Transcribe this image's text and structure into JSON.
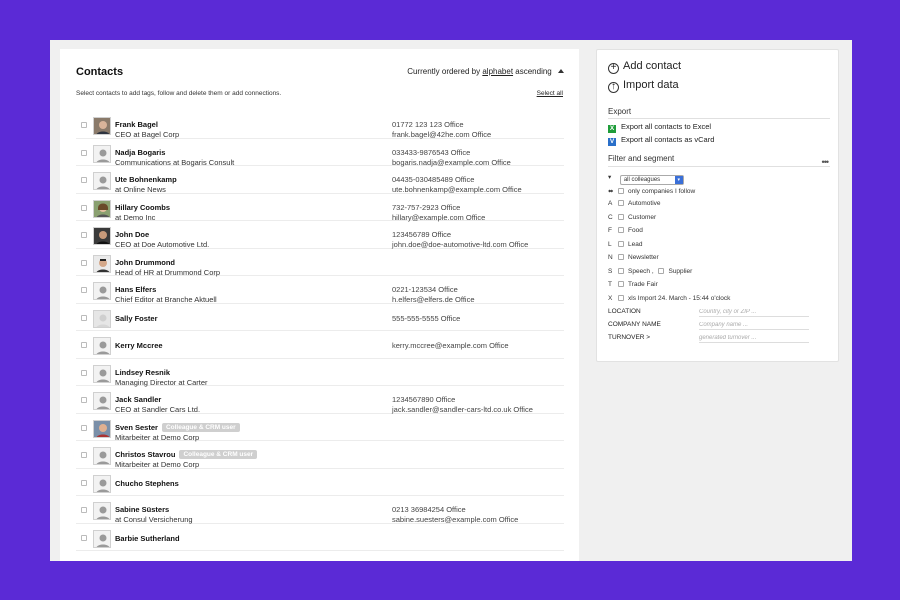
{
  "main": {
    "title": "Contacts",
    "order_prefix": "Currently ordered by",
    "order_link": "alphabet",
    "order_dir": "ascending",
    "instructions": "Select contacts to add tags, follow and delete them or add connections.",
    "select_all": "Select all"
  },
  "contacts": [
    {
      "name": "Frank Bagel",
      "sub": "CEO at Bagel Corp",
      "phone": "01772 123 123 Office",
      "email": "frank.bagel@42he.com Office",
      "avatar": "photo-man-1"
    },
    {
      "name": "Nadja Bogaris",
      "sub": "Communications at Bogaris Consult",
      "phone": "033433-9876543 Office",
      "email": "bogaris.nadja@example.com Office",
      "avatar": "placeholder"
    },
    {
      "name": "Ute Bohnenkamp",
      "sub": "at Online News",
      "phone": "04435-030485489 Office",
      "email": "ute.bohnenkamp@example.com Office",
      "avatar": "placeholder"
    },
    {
      "name": "Hillary Coombs",
      "sub": "at Demo Inc",
      "phone": "732-757-2923 Office",
      "email": "hillary@example.com Office",
      "avatar": "photo-woman-1"
    },
    {
      "name": "John Doe",
      "sub": "CEO at Doe Automotive Ltd.",
      "phone": "123456789 Office",
      "email": "john.doe@doe-automotive-ltd.com Office",
      "avatar": "photo-man-2"
    },
    {
      "name": "John Drummond",
      "sub": "Head of HR at Drummond Corp",
      "phone": "",
      "email": "",
      "avatar": "photo-man-3"
    },
    {
      "name": "Hans Elfers",
      "sub": "Chief Editor at Branche Aktuell",
      "phone": "0221-123534 Office",
      "email": "h.elfers@elfers.de Office",
      "avatar": "placeholder"
    },
    {
      "name": "Sally Foster",
      "sub": "",
      "phone": "",
      "email": "555-555-5555 Office",
      "avatar": "photo-woman-2"
    },
    {
      "name": "Kerry Mccree",
      "sub": "",
      "phone": "",
      "email": "kerry.mccree@example.com Office",
      "avatar": "placeholder"
    },
    {
      "name": "Lindsey Resnik",
      "sub": "Managing Director at Carter",
      "phone": "",
      "email": "",
      "avatar": "placeholder"
    },
    {
      "name": "Jack Sandler",
      "sub": "CEO at Sandler Cars Ltd.",
      "phone": "1234567890 Office",
      "email": "jack.sandler@sandler-cars-ltd.co.uk Office",
      "avatar": "placeholder"
    },
    {
      "name": "Sven Sester",
      "badge": "Colleague & CRM user",
      "sub": "Mitarbeiter at Demo Corp",
      "phone": "",
      "email": "",
      "avatar": "photo-man-4"
    },
    {
      "name": "Christos Stavrou",
      "badge": "Colleague & CRM user",
      "sub": "Mitarbeiter at Demo Corp",
      "phone": "",
      "email": "",
      "avatar": "placeholder"
    },
    {
      "name": "Chucho Stephens",
      "sub": "",
      "phone": "",
      "email": "",
      "avatar": "placeholder"
    },
    {
      "name": "Sabine Süsters",
      "sub": "at Consul Versicherung",
      "phone": "0213 36984254 Office",
      "email": "sabine.suesters@example.com Office",
      "avatar": "placeholder"
    },
    {
      "name": "Barbie Sutherland",
      "sub": "",
      "phone": "",
      "email": "",
      "avatar": "placeholder"
    }
  ],
  "side": {
    "add_contact": "Add contact",
    "import_data": "Import data",
    "export_title": "Export",
    "export_excel": "Export all contacts to Excel",
    "export_vcard": "Export all contacts as vCard",
    "excel_icon_letter": "X",
    "vcard_icon_letter": "V",
    "filter_title": "Filter and segment",
    "more": "•••",
    "colleagues_select": "all colleagues",
    "follow_label": "only companies I follow",
    "filters": [
      {
        "key": "A",
        "label": "Automotive"
      },
      {
        "key": "C",
        "label": "Customer"
      },
      {
        "key": "F",
        "label": "Food"
      },
      {
        "key": "L",
        "label": "Lead"
      },
      {
        "key": "N",
        "label": "Newsletter"
      },
      {
        "key": "S",
        "label": "Speech ,",
        "extra": "Supplier"
      },
      {
        "key": "T",
        "label": "Trade Fair"
      },
      {
        "key": "X",
        "label": "xls Import 24. March - 15:44 o'clock"
      }
    ],
    "location_label": "LOCATION",
    "location_placeholder": "Country, city or ZIP ...",
    "company_label": "COMPANY NAME",
    "company_placeholder": "Company name ...",
    "turnover_label": "TURNOVER >",
    "turnover_placeholder": "generated turnover ..."
  },
  "colors": {
    "background": "#5b2ad6",
    "excel": "#1f9d3a",
    "vcard": "#2a6fc9",
    "select_arrow": "#3a6fd8"
  }
}
